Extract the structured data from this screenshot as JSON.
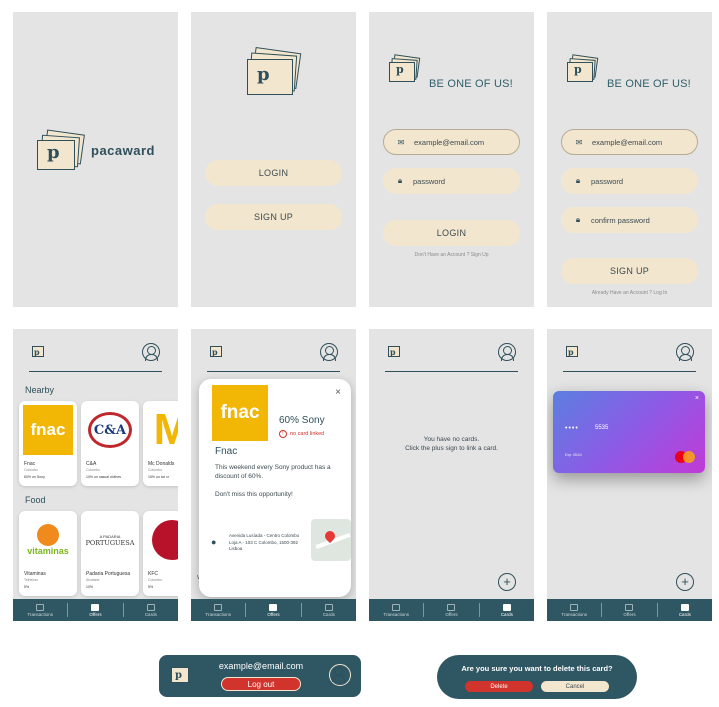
{
  "splash": {
    "brand": "pacaward",
    "logo_letter": "p"
  },
  "welcome": {
    "login_label": "LOGIN",
    "signup_label": "SIGN UP"
  },
  "login": {
    "heading": "BE ONE OF US!",
    "email_placeholder": "example@email.com",
    "password_placeholder": "password",
    "login_label": "LOGIN",
    "footer": "Don't Have an Account ? Sign Up"
  },
  "signup": {
    "heading": "BE ONE OF US!",
    "email_placeholder": "example@email.com",
    "password_placeholder": "password",
    "confirm_placeholder": "confirm password",
    "signup_label": "SIGN UP",
    "footer": "Already Have an Account ? Log In"
  },
  "offers": {
    "sections": [
      "Nearby",
      "Food"
    ],
    "nearby": [
      {
        "name": "Fnac",
        "city": "Colombo",
        "deal": "60% on Sony"
      },
      {
        "name": "C&A",
        "city": "Colombo",
        "deal": "10% on casual clothes"
      },
      {
        "name": "Mc Donalds",
        "city": "Colombo",
        "deal": "15% on ice cr"
      }
    ],
    "food": [
      {
        "name": "Vitaminas",
        "city": "Telheiras",
        "deal": "5%"
      },
      {
        "name": "Padaria Portuguesa",
        "city": "Alvalade",
        "deal": "10%"
      },
      {
        "name": "KFC",
        "city": "Colombo",
        "deal": "5%"
      }
    ],
    "logos": {
      "fnac": "fnac",
      "cna": "C&A",
      "vitaminas": "vitaminas",
      "padaria": "PORTUGUESA",
      "padaria_top": "A PADARIA"
    }
  },
  "offer_detail": {
    "title": "60% Sony",
    "warning": "no card linked",
    "store": "Fnac",
    "description": "This weekend every Sony product has a discount of 60%.",
    "cta": "Don't miss this opportunity!",
    "address": "Avenida Lusíada - Centro Colombo Loja A - 103 C Colombo, 1500-392 Lisboa",
    "close": "×"
  },
  "cards_empty": {
    "line1": "You have no cards.",
    "line2": "Click the plus sign to link a card."
  },
  "cards_filled": {
    "card_dots": "••••",
    "card_last": "5535",
    "card_exp": "Exp: 05/24"
  },
  "tabs": [
    "Transactions",
    "Offers",
    "Cards"
  ],
  "logout_banner": {
    "email": "example@email.com",
    "logout_label": "Log out"
  },
  "delete_banner": {
    "question": "Are you sure you want to delete this card?",
    "delete_label": "Delete",
    "cancel_label": "Cancel"
  },
  "colors": {
    "teal": "#2f5663",
    "cream": "#f3e6cf",
    "bg": "#e4e4e4",
    "red": "#d0342c"
  }
}
